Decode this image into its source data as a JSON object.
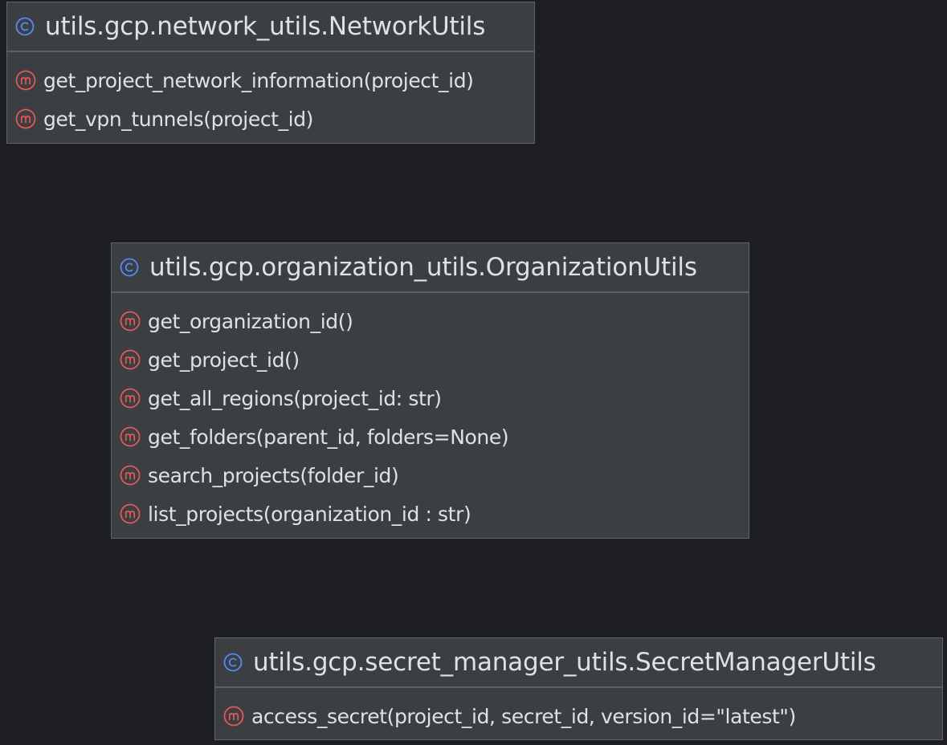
{
  "colors": {
    "background": "#1e1f22",
    "box_fill": "#3c3f41",
    "box_border": "#616468",
    "text": "#dfe1e5",
    "class_icon": "#548af7",
    "method_icon": "#e55757"
  },
  "icons": {
    "class": "class-icon",
    "method": "method-icon"
  },
  "classes": [
    {
      "title": "utils.gcp.network_utils.NetworkUtils",
      "methods": [
        "get_project_network_information(project_id)",
        "get_vpn_tunnels(project_id)"
      ]
    },
    {
      "title": "utils.gcp.organization_utils.OrganizationUtils",
      "methods": [
        "get_organization_id()",
        "get_project_id()",
        "get_all_regions(project_id: str)",
        "get_folders(parent_id, folders=None)",
        "search_projects(folder_id)",
        "list_projects(organization_id : str)"
      ]
    },
    {
      "title": "utils.gcp.secret_manager_utils.SecretManagerUtils",
      "methods": [
        "access_secret(project_id, secret_id, version_id=\"latest\")"
      ]
    }
  ]
}
